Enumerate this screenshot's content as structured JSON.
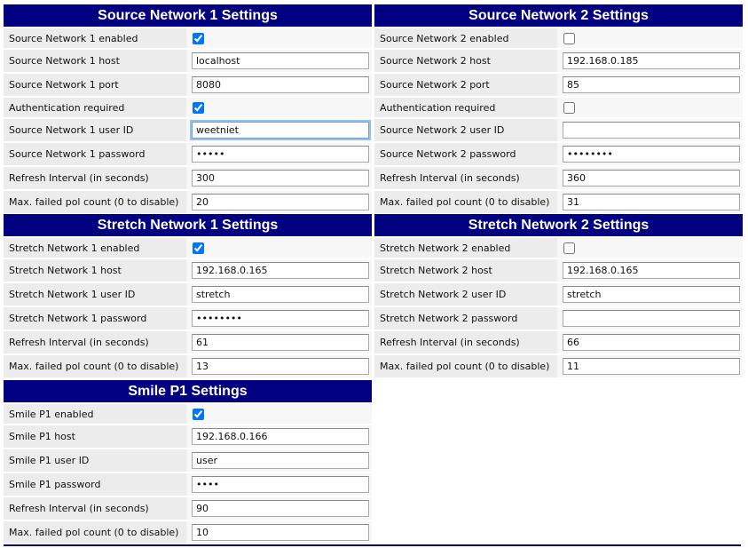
{
  "panels": [
    {
      "title": "Source Network 1 Settings",
      "rows": [
        {
          "label": "Source Network 1 enabled",
          "kind": "checkbox",
          "checked": true
        },
        {
          "label": "Source Network 1 host",
          "kind": "text",
          "value": "localhost"
        },
        {
          "label": "Source Network 1 port",
          "kind": "text",
          "value": "8080"
        },
        {
          "label": "Authentication required",
          "kind": "checkbox",
          "checked": true
        },
        {
          "label": "Source Network 1 user ID",
          "kind": "text",
          "value": "weetniet",
          "focused": true
        },
        {
          "label": "Source Network 1 password",
          "kind": "password",
          "value": "•••••"
        },
        {
          "label": "Refresh Interval (in seconds)",
          "kind": "text",
          "value": "300"
        },
        {
          "label": "Max. failed pol count (0 to disable)",
          "kind": "text",
          "value": "20"
        }
      ]
    },
    {
      "title": "Source Network 2 Settings",
      "rows": [
        {
          "label": "Source Network 2 enabled",
          "kind": "checkbox",
          "checked": false
        },
        {
          "label": "Source Network 2 host",
          "kind": "text",
          "value": "192.168.0.185"
        },
        {
          "label": "Source Network 2 port",
          "kind": "text",
          "value": "85"
        },
        {
          "label": "Authentication required",
          "kind": "checkbox",
          "checked": false
        },
        {
          "label": "Source Network 2 user ID",
          "kind": "text",
          "value": ""
        },
        {
          "label": "Source Network 2 password",
          "kind": "password",
          "value": "••••••••"
        },
        {
          "label": "Refresh Interval (in seconds)",
          "kind": "text",
          "value": "360"
        },
        {
          "label": "Max. failed pol count (0 to disable)",
          "kind": "text",
          "value": "31"
        }
      ]
    },
    {
      "title": "Stretch Network 1 Settings",
      "rows": [
        {
          "label": "Stretch Network 1 enabled",
          "kind": "checkbox",
          "checked": true
        },
        {
          "label": "Stretch Network 1 host",
          "kind": "text",
          "value": "192.168.0.165"
        },
        {
          "label": "Stretch Network 1 user ID",
          "kind": "text",
          "value": "stretch"
        },
        {
          "label": "Stretch Network 1 password",
          "kind": "password",
          "value": "••••••••"
        },
        {
          "label": "Refresh Interval (in seconds)",
          "kind": "text",
          "value": "61"
        },
        {
          "label": "Max. failed pol count (0 to disable)",
          "kind": "text",
          "value": "13"
        }
      ]
    },
    {
      "title": "Stretch Network 2 Settings",
      "rows": [
        {
          "label": "Stretch Network 2 enabled",
          "kind": "checkbox",
          "checked": false
        },
        {
          "label": "Stretch Network 2 host",
          "kind": "text",
          "value": "192.168.0.165"
        },
        {
          "label": "Stretch Network 2 user ID",
          "kind": "text",
          "value": "stretch"
        },
        {
          "label": "Stretch Network 2 password",
          "kind": "password",
          "value": ""
        },
        {
          "label": "Refresh Interval (in seconds)",
          "kind": "text",
          "value": "66"
        },
        {
          "label": "Max. failed pol count (0 to disable)",
          "kind": "text",
          "value": "11"
        }
      ]
    },
    {
      "title": "Smile P1 Settings",
      "rows": [
        {
          "label": "Smile P1 enabled",
          "kind": "checkbox",
          "checked": true
        },
        {
          "label": "Smile P1 host",
          "kind": "text",
          "value": "192.168.0.166"
        },
        {
          "label": "Smile P1 user ID",
          "kind": "text",
          "value": "user"
        },
        {
          "label": "Smile P1 password",
          "kind": "password",
          "value": "••••"
        },
        {
          "label": "Refresh Interval (in seconds)",
          "kind": "text",
          "value": "90"
        },
        {
          "label": "Max. failed pol count (0 to disable)",
          "kind": "text",
          "value": "10"
        }
      ]
    }
  ],
  "colors": {
    "header_background": "#000080",
    "header_text": "#ffffff",
    "label_background": "#ececec",
    "value_background": "#f7f7f7",
    "focus_ring": "#6d9fdd"
  }
}
